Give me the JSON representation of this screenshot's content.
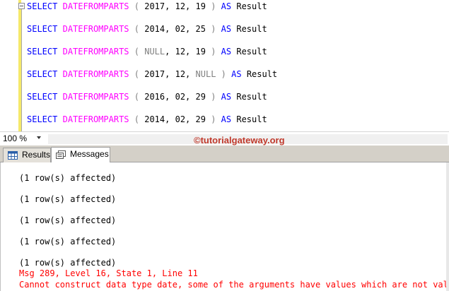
{
  "editor": {
    "lines": [
      {
        "kw1": "SELECT",
        "fn": "DATEFROMPARTS",
        "open": "(",
        "a": "2017",
        "c1": ",",
        "b": "12",
        "c2": ",",
        "c": "19",
        "close": ")",
        "kw2": "AS",
        "alias": "Result",
        "a_null": false,
        "c_null": false
      },
      {
        "kw1": "SELECT",
        "fn": "DATEFROMPARTS",
        "open": "(",
        "a": "2014",
        "c1": ",",
        "b": "02",
        "c2": ",",
        "c": "25",
        "close": ")",
        "kw2": "AS",
        "alias": "Result",
        "a_null": false,
        "c_null": false
      },
      {
        "kw1": "SELECT",
        "fn": "DATEFROMPARTS",
        "open": "(",
        "a": "NULL",
        "c1": ",",
        "b": "12",
        "c2": ",",
        "c": "19",
        "close": ")",
        "kw2": "AS",
        "alias": "Result",
        "a_null": true,
        "c_null": false
      },
      {
        "kw1": "SELECT",
        "fn": "DATEFROMPARTS",
        "open": "(",
        "a": "2017",
        "c1": ",",
        "b": "12",
        "c2": ",",
        "c": "NULL",
        "close": ")",
        "kw2": "AS",
        "alias": "Result",
        "a_null": false,
        "c_null": true
      },
      {
        "kw1": "SELECT",
        "fn": "DATEFROMPARTS",
        "open": "(",
        "a": "2016",
        "c1": ",",
        "b": "02",
        "c2": ",",
        "c": "29",
        "close": ")",
        "kw2": "AS",
        "alias": "Result",
        "a_null": false,
        "c_null": false
      },
      {
        "kw1": "SELECT",
        "fn": "DATEFROMPARTS",
        "open": "(",
        "a": "2014",
        "c1": ",",
        "b": "02",
        "c2": ",",
        "c": "29",
        "close": ")",
        "kw2": "AS",
        "alias": "Result",
        "a_null": false,
        "c_null": false
      }
    ]
  },
  "zoom": {
    "level": "100 %"
  },
  "watermark": "©tutorialgateway.org",
  "tabs": {
    "results": "Results",
    "messages": "Messages"
  },
  "messages": {
    "affected": [
      "(1 row(s) affected)",
      "(1 row(s) affected)",
      "(1 row(s) affected)",
      "(1 row(s) affected)",
      "(1 row(s) affected)"
    ],
    "error_header": "Msg 289, Level 16, State 1, Line 11",
    "error_text": "Cannot construct data type date, some of the arguments have values which are not valid."
  },
  "colors": {
    "keyword": "#0000ff",
    "function": "#ff00ff",
    "null": "#808080",
    "error": "#ff0000",
    "watermark": "#c0392b"
  }
}
